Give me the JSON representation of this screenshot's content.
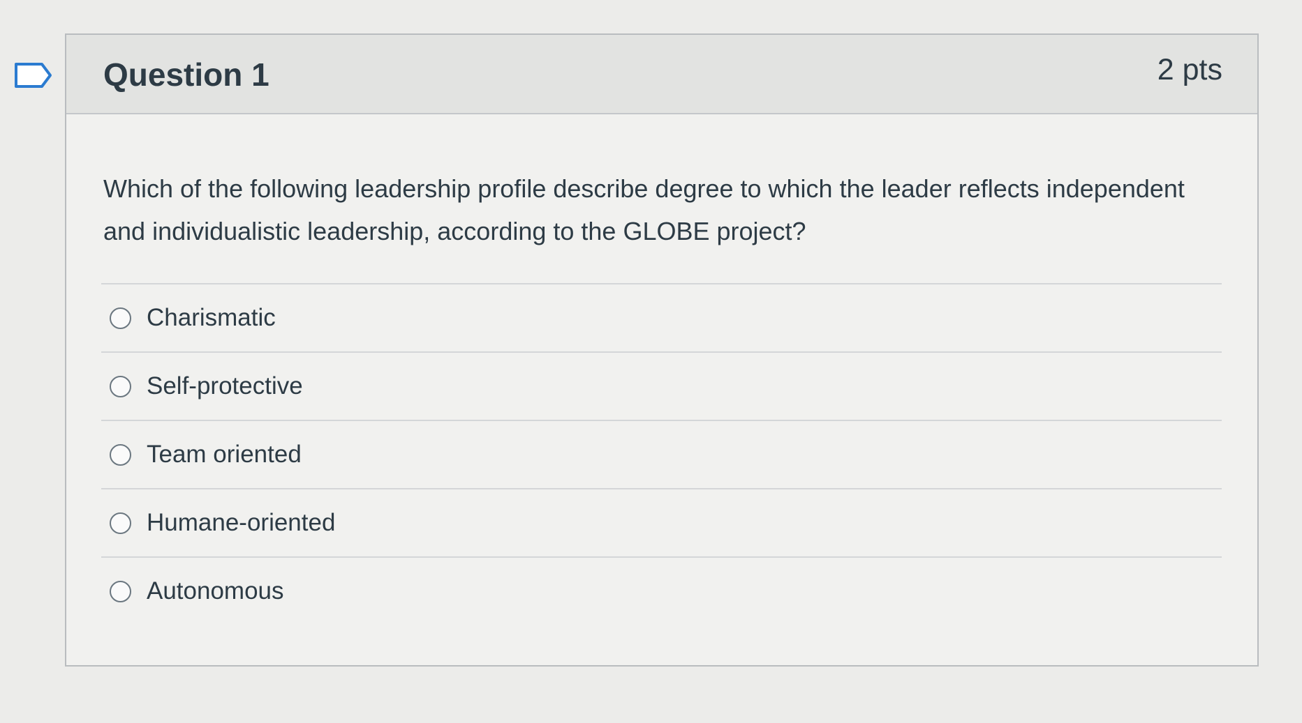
{
  "question": {
    "title": "Question 1",
    "points": "2 pts",
    "text": "Which of the following leadership profile describe degree to which the leader reflects independent and individualistic leadership, according to the GLOBE project?"
  },
  "answers": [
    {
      "label": "Charismatic"
    },
    {
      "label": "Self-protective"
    },
    {
      "label": "Team oriented"
    },
    {
      "label": "Humane-oriented"
    },
    {
      "label": "Autonomous"
    }
  ],
  "icons": {
    "flag": "flag-question-icon"
  },
  "colors": {
    "header_bg": "#e2e3e1",
    "text": "#2d3b45",
    "border": "#b9bcbf"
  }
}
